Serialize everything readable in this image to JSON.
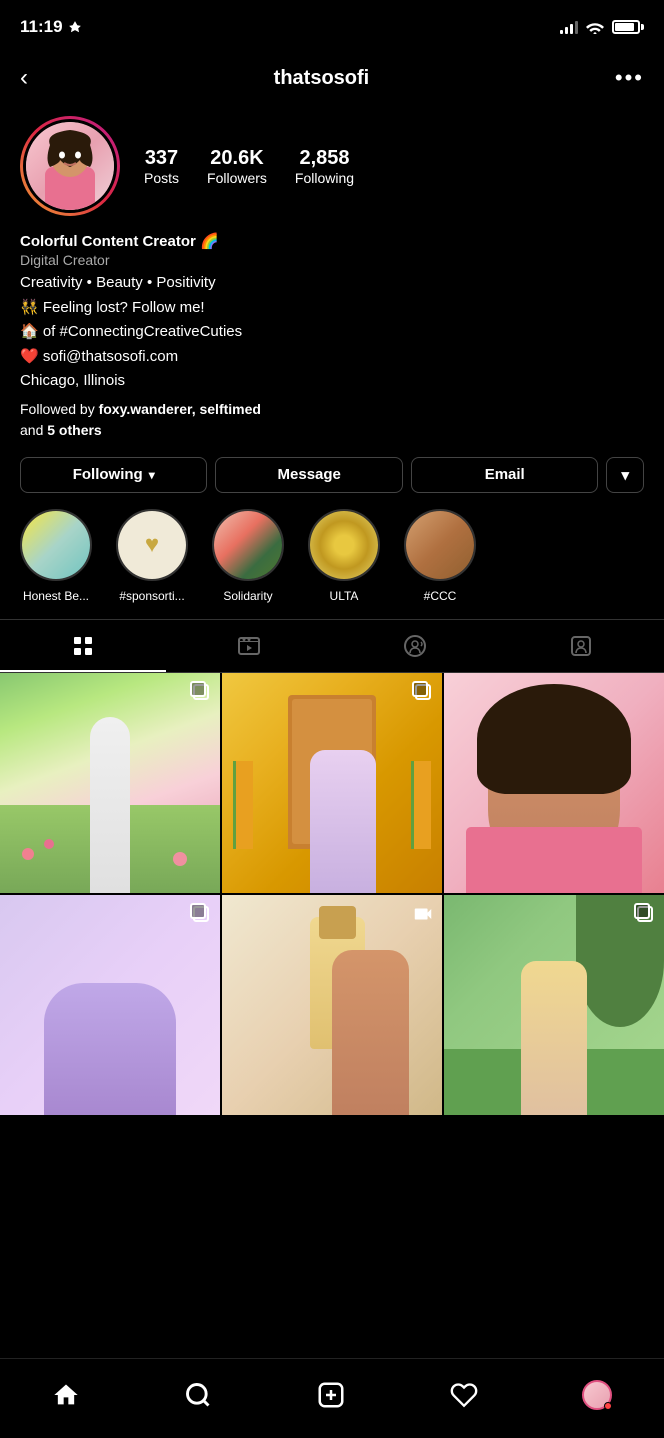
{
  "status": {
    "time": "11:19",
    "location_arrow": "➤"
  },
  "header": {
    "back_label": "‹",
    "username": "thatsosofi",
    "more_label": "•••"
  },
  "profile": {
    "stats": {
      "posts_count": "337",
      "posts_label": "Posts",
      "followers_count": "20.6K",
      "followers_label": "Followers",
      "following_count": "2,858",
      "following_label": "Following"
    },
    "bio": {
      "name": "Colorful Content Creator 🌈",
      "category": "Digital Creator",
      "line1": "Creativity • Beauty • Positivity",
      "line2": "👯 Feeling lost? Follow me!",
      "line3": "🏠 of #ConnectingCreativeCuties",
      "line4": "❤️ sofi@thatsosofi.com",
      "line5": "Chicago, Illinois",
      "followed_by_prefix": "Followed by ",
      "followed_by_users": "foxy.wanderer, selftimed",
      "followed_by_suffix": "and ",
      "followed_by_count": "5 others"
    },
    "buttons": {
      "following": "Following",
      "message": "Message",
      "email": "Email",
      "dropdown": "▾"
    }
  },
  "highlights": [
    {
      "label": "Honest Be...",
      "color1": "#f5e642",
      "color2": "#7ec8c8"
    },
    {
      "label": "#sponsorti...",
      "color1": "#f5f0e8",
      "color2": "#e8d8c0"
    },
    {
      "label": "Solidarity",
      "color1": "#f5c5b0",
      "color2": "#4a7c4e"
    },
    {
      "label": "ULTA",
      "color1": "#e8c840",
      "color2": "#e8d880"
    },
    {
      "label": "#CCC",
      "color1": "#d4a070",
      "color2": "#8c6030"
    }
  ],
  "tabs": {
    "grid_icon": "⊞",
    "reels_icon": "📺",
    "collab_icon": "😊",
    "tagged_icon": "👤"
  },
  "grid": {
    "photos": [
      {
        "id": 1,
        "has_multi": true
      },
      {
        "id": 2,
        "has_multi": true
      },
      {
        "id": 3,
        "has_multi": false
      },
      {
        "id": 4,
        "has_multi": true
      },
      {
        "id": 5,
        "has_reel": true
      },
      {
        "id": 6,
        "has_multi": true
      }
    ]
  },
  "bottom_nav": {
    "home": "🏠",
    "search": "🔍",
    "add": "➕",
    "heart": "🤍",
    "profile": "avatar"
  }
}
